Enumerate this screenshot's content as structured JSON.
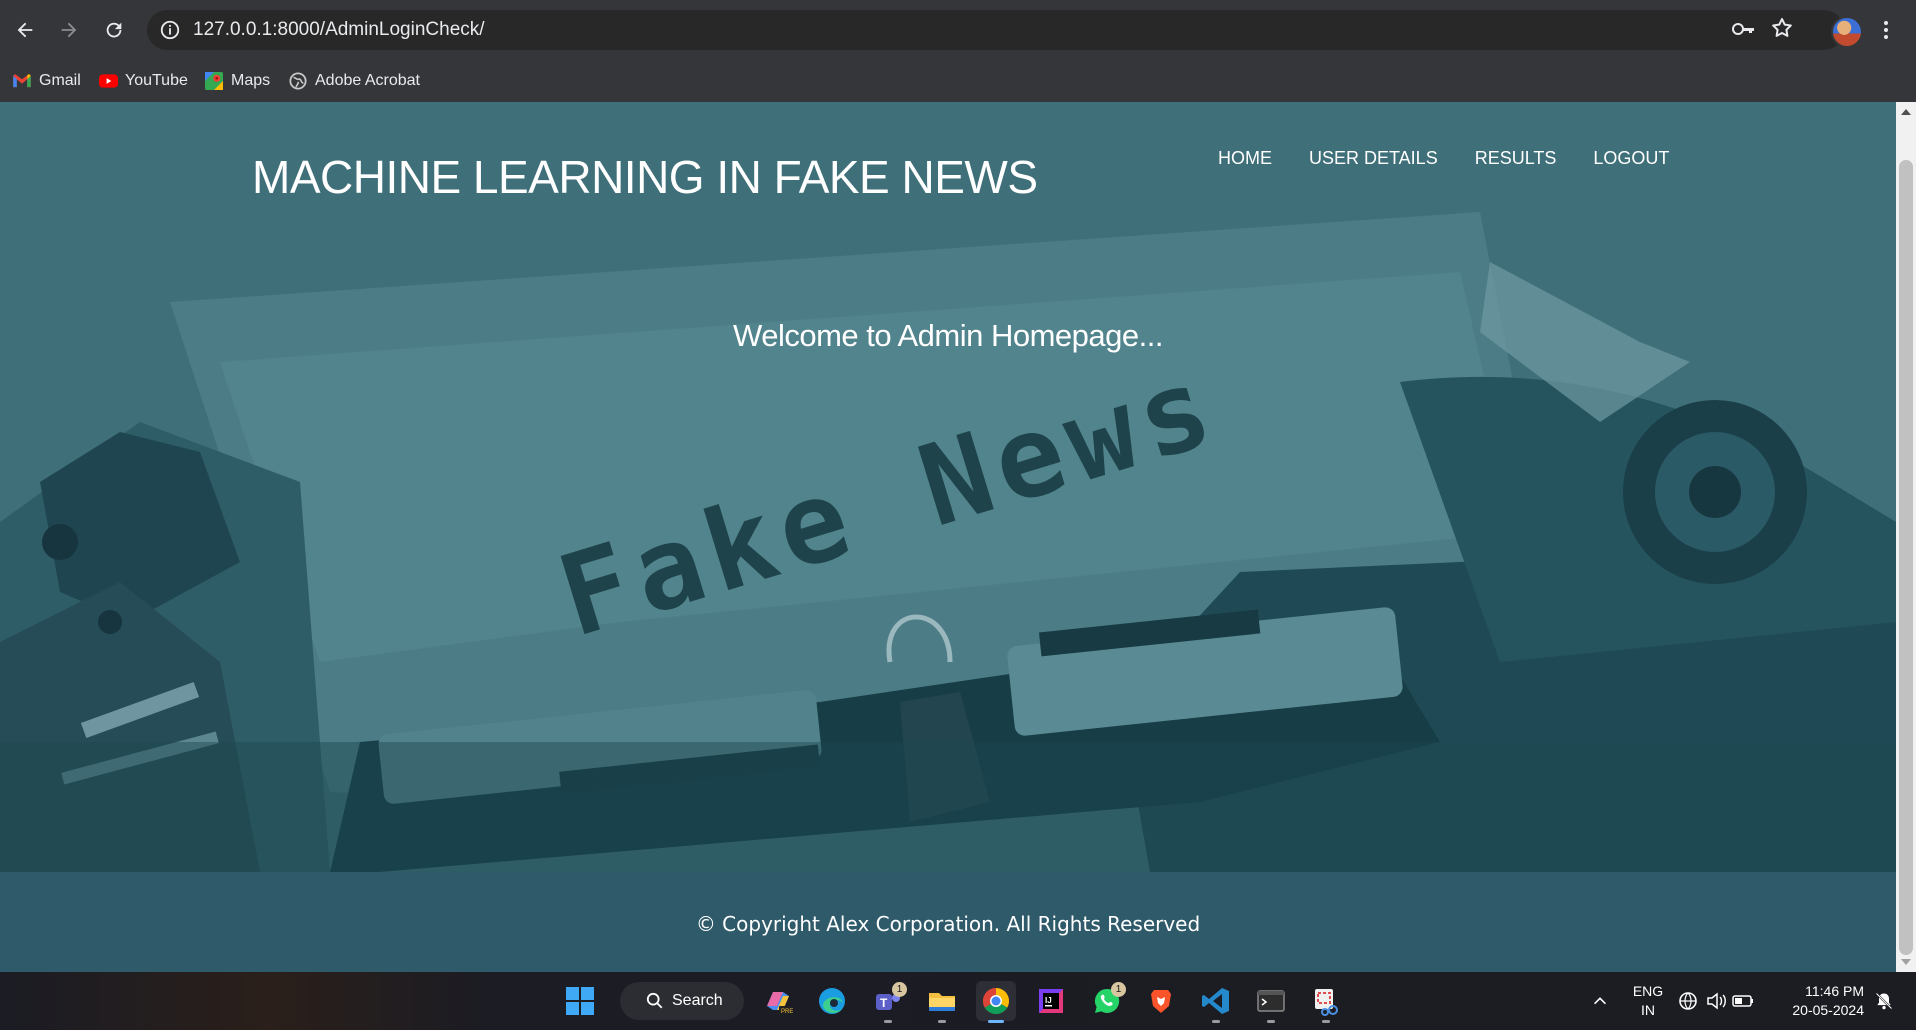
{
  "browser": {
    "url": "127.0.0.1:8000/AdminLoginCheck/",
    "bookmarks": [
      {
        "label": "Gmail",
        "icon": "gmail-icon"
      },
      {
        "label": "YouTube",
        "icon": "youtube-icon"
      },
      {
        "label": "Maps",
        "icon": "maps-icon"
      },
      {
        "label": "Adobe Acrobat",
        "icon": "globe-icon"
      }
    ]
  },
  "site": {
    "title": "MACHINE LEARNING IN FAKE NEWS",
    "nav": [
      "HOME",
      "USER DETAILS",
      "RESULTS",
      "LOGOUT"
    ],
    "welcome": "Welcome to Admin Homepage...",
    "hero_image_text": "Fake News",
    "footer": "© Copyright Alex Corporation. All Rights Reserved",
    "colors": {
      "hero_overlay": "#3f6f79",
      "footer_bg": "#2f5a6a"
    }
  },
  "taskbar": {
    "search_label": "Search",
    "apps": [
      {
        "name": "copilot",
        "badge": ""
      },
      {
        "name": "edge",
        "badge": ""
      },
      {
        "name": "teams",
        "badge": "1"
      },
      {
        "name": "file-explorer",
        "badge": ""
      },
      {
        "name": "chrome",
        "badge": ""
      },
      {
        "name": "intellij",
        "badge": ""
      },
      {
        "name": "whatsapp",
        "badge": "1"
      },
      {
        "name": "brave",
        "badge": ""
      },
      {
        "name": "vscode",
        "badge": ""
      },
      {
        "name": "terminal",
        "badge": ""
      },
      {
        "name": "snipping-tool",
        "badge": ""
      }
    ],
    "lang_top": "ENG",
    "lang_bottom": "IN",
    "time": "11:46 PM",
    "date": "20-05-2024"
  }
}
